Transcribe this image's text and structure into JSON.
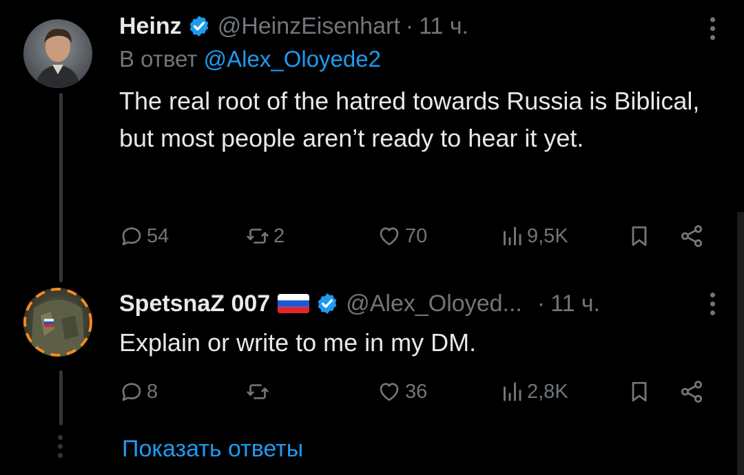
{
  "tweets": [
    {
      "name": "Heinz",
      "handle": "@HeinzEisenhart",
      "separator": "·",
      "time": "11 ч.",
      "reply_prefix": "В ответ",
      "reply_mention": "@Alex_Oloyede2",
      "text": "The real root of the hatred towards Russia is Biblical, but most people aren’t ready to hear it yet.",
      "stats": {
        "replies": "54",
        "retweets": "2",
        "likes": "70",
        "views": "9,5K"
      }
    },
    {
      "name": "SpetsnaZ 007",
      "flag_icon": "russia-flag-icon",
      "handle": "@Alex_Oloyed...",
      "separator": "·",
      "time": "11 ч.",
      "text": "Explain or write to me in my DM.",
      "stats": {
        "replies": "8",
        "retweets": "",
        "likes": "36",
        "views": "2,8K"
      }
    }
  ],
  "show_replies_label": "Показать ответы",
  "colors": {
    "background": "#000000",
    "text": "#e7e9ea",
    "secondary": "#71767b",
    "accent": "#1d9bf0",
    "thread_line": "#333639"
  }
}
